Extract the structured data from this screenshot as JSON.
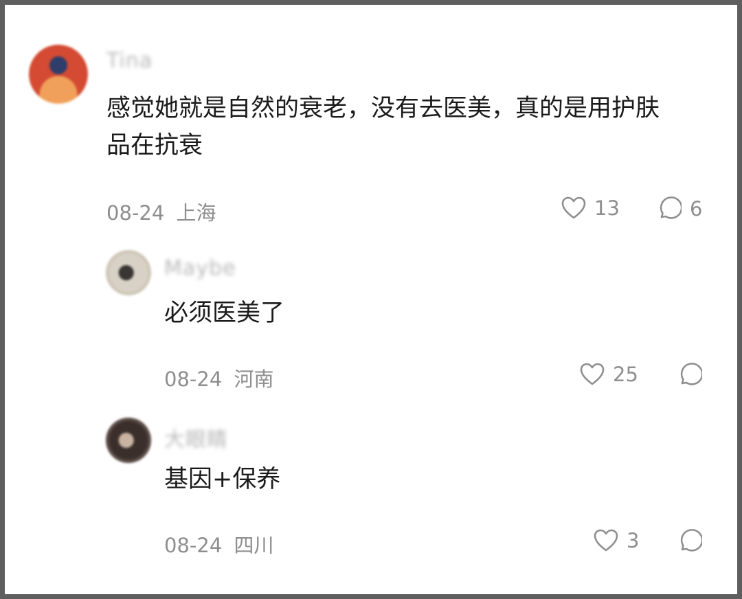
{
  "comments": [
    {
      "username": "Tina",
      "text_line1": "感觉她就是自然的衰老，没有去医美，真的是用护肤",
      "text_line2": "品在抗衰",
      "date": "08-24",
      "location": "上海",
      "likes": "13",
      "replies": "6"
    },
    {
      "username": "Maybe",
      "text": "必须医美了",
      "date": "08-24",
      "location": "河南",
      "likes": "25",
      "replies": ""
    },
    {
      "username": "大眼睛",
      "text": "基因+保养",
      "date": "08-24",
      "location": "四川",
      "likes": "3",
      "replies": ""
    }
  ],
  "icons": {
    "like": "heart-icon",
    "reply": "speech-bubble-icon"
  },
  "colors": {
    "frame": "#5e5e5e",
    "text": "#1b1b1b",
    "meta": "#8e8e8e"
  }
}
